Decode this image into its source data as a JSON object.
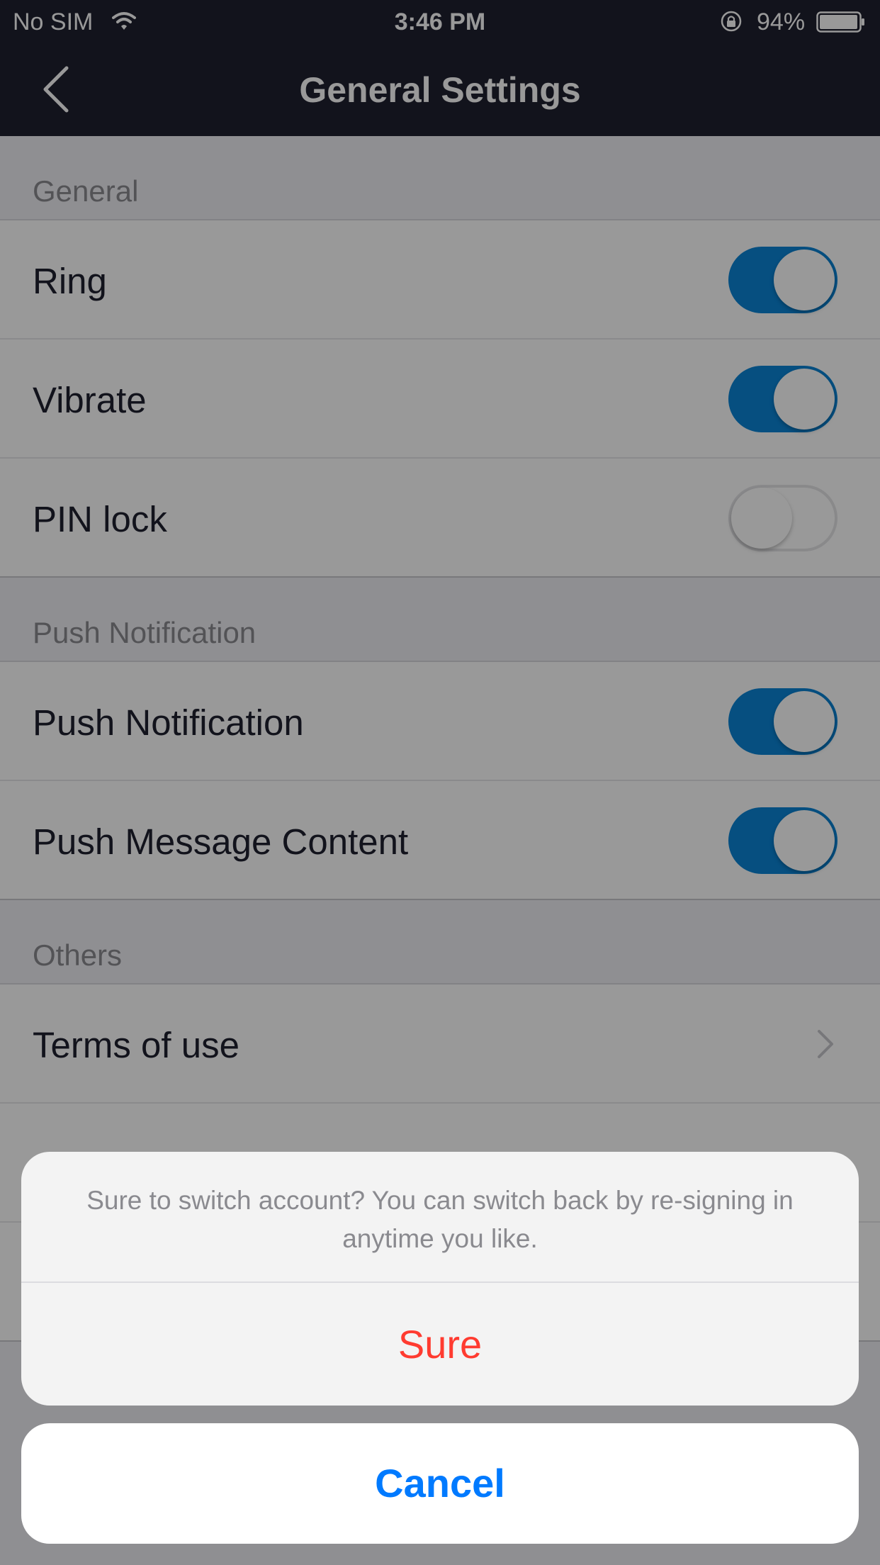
{
  "status_bar": {
    "carrier": "No SIM",
    "time": "3:46 PM",
    "battery_percent": "94%",
    "wifi_icon": "wifi-icon",
    "lock_icon": "rotation-lock-icon",
    "battery_icon": "battery-icon"
  },
  "nav": {
    "title": "General Settings",
    "back_icon": "chevron-left-icon"
  },
  "sections": {
    "general": {
      "header": "General",
      "ring": {
        "label": "Ring",
        "on": true
      },
      "vibrate": {
        "label": "Vibrate",
        "on": true
      },
      "pin_lock": {
        "label": "PIN lock",
        "on": false
      }
    },
    "push": {
      "header": "Push Notification",
      "push_notification": {
        "label": "Push Notification",
        "on": true
      },
      "push_message_content": {
        "label": "Push Message Content",
        "on": true
      }
    },
    "others": {
      "header": "Others",
      "terms": {
        "label": "Terms of use"
      }
    }
  },
  "action_sheet": {
    "message": "Sure to switch account? You can switch back by re-signing in anytime you like.",
    "confirm": "Sure",
    "cancel": "Cancel"
  },
  "colors": {
    "nav_bg": "#1f2030",
    "toggle_on": "#0a84d6",
    "destructive": "#ff3b30",
    "cancel": "#007aff"
  }
}
